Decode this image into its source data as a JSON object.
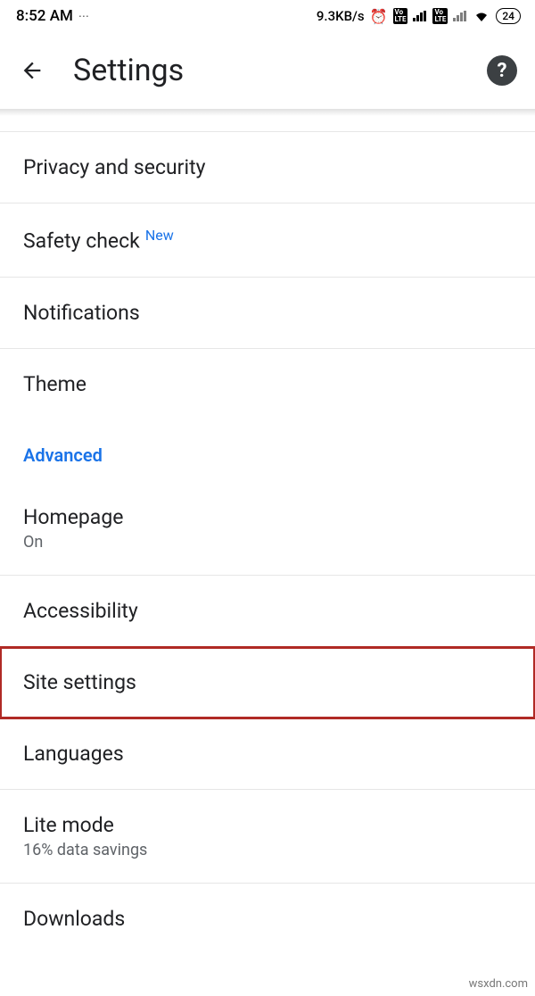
{
  "status": {
    "time": "8:52 AM",
    "data_rate": "9.3KB/s",
    "battery": "24",
    "lte": "VoLTE"
  },
  "appbar": {
    "title": "Settings"
  },
  "settings": {
    "privacy": "Privacy and security",
    "safety_check": "Safety check",
    "safety_check_badge": "New",
    "notifications": "Notifications",
    "theme": "Theme",
    "section_advanced": "Advanced",
    "homepage": {
      "label": "Homepage",
      "sub": "On"
    },
    "accessibility": "Accessibility",
    "site_settings": "Site settings",
    "languages": "Languages",
    "lite_mode": {
      "label": "Lite mode",
      "sub": "16% data savings"
    },
    "downloads": "Downloads"
  },
  "watermark": "wsxdn.com"
}
